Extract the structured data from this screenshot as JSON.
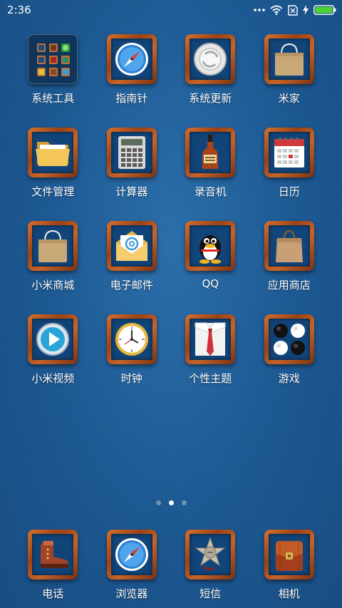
{
  "status_bar": {
    "time": "2:36",
    "icons": [
      "more-dots-icon",
      "wifi-icon",
      "no-sim-icon",
      "charging-icon",
      "battery-icon"
    ],
    "battery_color": "#4cd137"
  },
  "apps": [
    {
      "label": "系统工具",
      "icon": "folder-system-tools-icon"
    },
    {
      "label": "指南针",
      "icon": "compass-icon"
    },
    {
      "label": "系统更新",
      "icon": "system-update-icon"
    },
    {
      "label": "米家",
      "icon": "mijia-bag-icon"
    },
    {
      "label": "文件管理",
      "icon": "file-folder-icon"
    },
    {
      "label": "计算器",
      "icon": "calculator-icon"
    },
    {
      "label": "录音机",
      "icon": "recorder-bottle-icon"
    },
    {
      "label": "日历",
      "icon": "calendar-icon"
    },
    {
      "label": "小米商城",
      "icon": "mi-store-bag-icon"
    },
    {
      "label": "电子邮件",
      "icon": "email-envelope-icon"
    },
    {
      "label": "QQ",
      "icon": "qq-penguin-icon"
    },
    {
      "label": "应用商店",
      "icon": "app-store-bag-icon"
    },
    {
      "label": "小米视频",
      "icon": "video-play-icon"
    },
    {
      "label": "时钟",
      "icon": "clock-icon"
    },
    {
      "label": "个性主题",
      "icon": "theme-shirt-tie-icon"
    },
    {
      "label": "游戏",
      "icon": "game-go-stones-icon"
    }
  ],
  "page_indicator": {
    "count": 3,
    "active": 2
  },
  "dock": [
    {
      "label": "电话",
      "icon": "phone-boot-icon"
    },
    {
      "label": "浏览器",
      "icon": "browser-compass-icon"
    },
    {
      "label": "短信",
      "icon": "messaging-sheriff-badge-icon"
    },
    {
      "label": "相机",
      "icon": "camera-leather-bag-icon"
    }
  ],
  "colors": {
    "wallpaper": "#1d5a93",
    "frame_wood": "#c0581f",
    "icon_inner": "#11457a"
  }
}
